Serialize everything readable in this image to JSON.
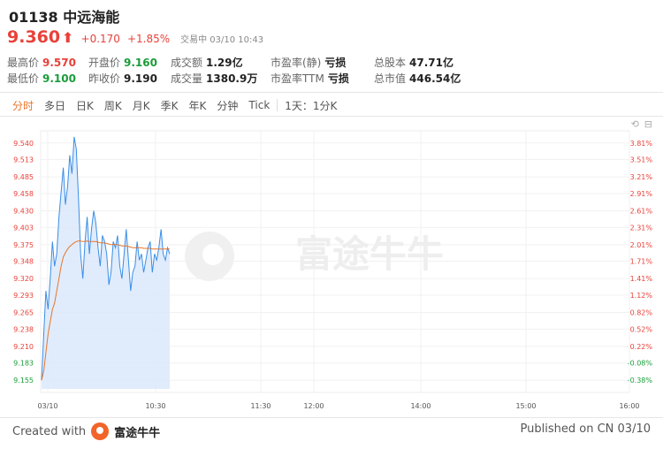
{
  "stock": {
    "code_name": "01138 中远海能",
    "price": "9.360",
    "arrow": "⬆",
    "change": "+0.170",
    "change_pct": "+1.85%",
    "status": "交易中 03/10 10:43"
  },
  "stats": [
    {
      "label": "最高价",
      "value": "9.570",
      "color": "up"
    },
    {
      "label": "开盘价",
      "value": "9.160",
      "color": "down"
    },
    {
      "label": "成交额",
      "value": "1.29亿",
      "color": ""
    },
    {
      "label": "市盈率(静)",
      "value": "亏损",
      "color": ""
    },
    {
      "label": "总股本",
      "value": "47.71亿",
      "color": ""
    },
    {
      "label": "最低价",
      "value": "9.100",
      "color": "down"
    },
    {
      "label": "昨收价",
      "value": "9.190",
      "color": ""
    },
    {
      "label": "成交量",
      "value": "1380.9万",
      "color": ""
    },
    {
      "label": "市盈率TTM",
      "value": "亏损",
      "color": ""
    },
    {
      "label": "总市值",
      "value": "446.54亿",
      "color": ""
    }
  ],
  "tabs": [
    "分时",
    "多日",
    "日K",
    "周K",
    "月K",
    "季K",
    "年K",
    "分钟",
    "Tick",
    "1天：1分K"
  ],
  "chart_icons": [
    "⟲",
    "⊟"
  ],
  "chart_data": {
    "type": "line",
    "y_left_ticks": [
      "9.540",
      "9.513",
      "9.485",
      "9.458",
      "9.430",
      "9.403",
      "9.375",
      "9.348",
      "9.320",
      "9.293",
      "9.265",
      "9.238",
      "9.210",
      "9.183",
      "9.155"
    ],
    "y_right_ticks": [
      "3.81%",
      "3.51%",
      "3.21%",
      "2.91%",
      "2.61%",
      "2.31%",
      "2.01%",
      "1.71%",
      "1.41%",
      "1.12%",
      "0.82%",
      "0.52%",
      "0.22%",
      "-0.08%",
      "-0.38%"
    ],
    "x_ticks": [
      "03/10",
      "10:30",
      "11:30",
      "12:00",
      "14:00",
      "15:00",
      "16:00"
    ],
    "ylim": [
      9.141,
      9.554
    ],
    "prev_close": 9.19,
    "price_series": [
      9.155,
      9.23,
      9.3,
      9.27,
      9.32,
      9.38,
      9.34,
      9.36,
      9.42,
      9.46,
      9.5,
      9.44,
      9.47,
      9.52,
      9.49,
      9.55,
      9.53,
      9.45,
      9.36,
      9.32,
      9.38,
      9.42,
      9.36,
      9.4,
      9.43,
      9.41,
      9.37,
      9.34,
      9.39,
      9.38,
      9.36,
      9.31,
      9.33,
      9.38,
      9.37,
      9.39,
      9.34,
      9.32,
      9.36,
      9.4,
      9.35,
      9.3,
      9.33,
      9.34,
      9.38,
      9.35,
      9.36,
      9.33,
      9.35,
      9.37,
      9.38,
      9.33,
      9.36,
      9.35,
      9.37,
      9.4,
      9.36,
      9.35,
      9.37,
      9.36
    ],
    "avg_series": [
      9.155,
      9.17,
      9.2,
      9.23,
      9.25,
      9.27,
      9.28,
      9.3,
      9.32,
      9.34,
      9.355,
      9.362,
      9.368,
      9.372,
      9.375,
      9.378,
      9.38,
      9.381,
      9.381,
      9.38,
      9.38,
      9.381,
      9.38,
      9.38,
      9.38,
      9.38,
      9.379,
      9.378,
      9.378,
      9.378,
      9.377,
      9.376,
      9.375,
      9.375,
      9.375,
      9.375,
      9.374,
      9.373,
      9.373,
      9.373,
      9.372,
      9.371,
      9.37,
      9.37,
      9.37,
      9.37,
      9.37,
      9.369,
      9.369,
      9.369,
      9.369,
      9.368,
      9.368,
      9.368,
      9.368,
      9.368,
      9.368,
      9.368,
      9.368,
      9.368
    ],
    "colors": {
      "price_line": "#3a8ee6",
      "avg_line": "#e8752a",
      "area": "#dbe9fb",
      "up": "#e8413a",
      "down": "#1a9c3a"
    },
    "watermark": "富途牛牛"
  },
  "footer": {
    "created_with": "Created with",
    "brand": "富途牛牛",
    "published": "Published on CN 03/10"
  }
}
